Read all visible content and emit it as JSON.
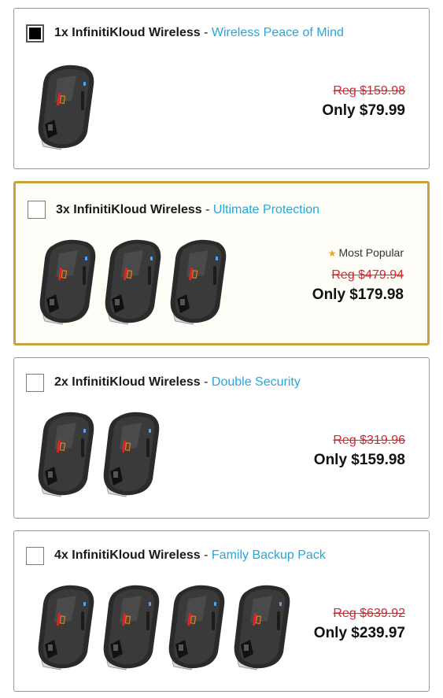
{
  "options": [
    {
      "qty_title": "1x InfinitiKloud Wireless",
      "separator": " - ",
      "subtitle": "Wireless Peace of Mind",
      "reg_price": "Reg $159.98",
      "price": "Only $79.99",
      "checked": true,
      "devices": 1
    },
    {
      "qty_title": "3x InfinitiKloud Wireless",
      "separator": " - ",
      "subtitle": "Ultimate Protection",
      "badge": "Most Popular",
      "reg_price": "Reg $479.94",
      "price": "Only $179.98",
      "checked": false,
      "devices": 3
    },
    {
      "qty_title": "2x InfinitiKloud Wireless",
      "separator": " - ",
      "subtitle": "Double Security",
      "reg_price": "Reg $319.96",
      "price": "Only $159.98",
      "checked": false,
      "devices": 2
    },
    {
      "qty_title": "4x InfinitiKloud Wireless",
      "separator": " - ",
      "subtitle": "Family Backup Pack",
      "reg_price": "Reg $639.92",
      "price": "Only $239.97",
      "checked": false,
      "devices": 4
    }
  ],
  "colors": {
    "accent": "#27a6de",
    "strike": "#d9252b",
    "featured_border": "#c9a23e",
    "star": "#f2a31b"
  }
}
